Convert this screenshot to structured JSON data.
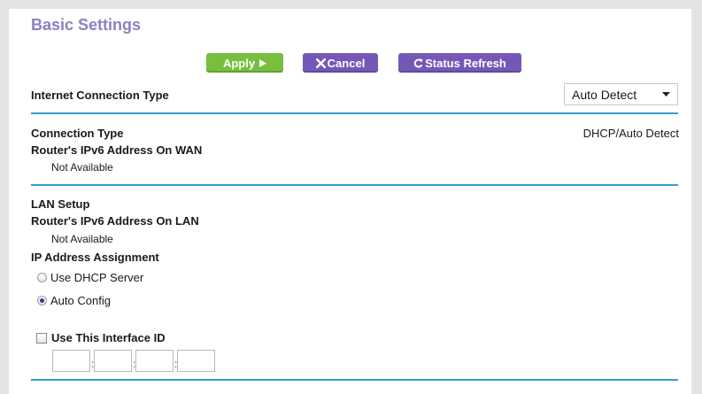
{
  "page": {
    "title": "Basic Settings"
  },
  "toolbar": {
    "apply_label": "Apply",
    "cancel_label": "Cancel",
    "refresh_label": "Status Refresh"
  },
  "internet_connection": {
    "label": "Internet Connection Type",
    "selected": "Auto Detect"
  },
  "wan": {
    "connection_type_label": "Connection Type",
    "connection_type_value": "DHCP/Auto Detect",
    "ipv6_label": "Router's IPv6 Address On WAN",
    "ipv6_value": "Not Available"
  },
  "lan": {
    "section_label": "LAN Setup",
    "ipv6_label": "Router's IPv6 Address On LAN",
    "ipv6_value": "Not Available",
    "assignment_label": "IP Address Assignment",
    "options": [
      {
        "label": "Use DHCP Server",
        "checked": false
      },
      {
        "label": "Auto Config",
        "checked": true
      }
    ],
    "interface_id_label": "Use This Interface ID",
    "interface_id_checked": false,
    "interface_id_fields": [
      "",
      "",
      "",
      ""
    ]
  },
  "colors": {
    "title": "#8f7fc1",
    "apply": "#77bf3c",
    "secondary_button": "#7458b8",
    "divider": "#2d9fd3"
  },
  "icons": {
    "apply": "play-arrow-icon",
    "cancel": "x-icon",
    "refresh": "refresh-icon",
    "select": "chevron-down-icon"
  }
}
